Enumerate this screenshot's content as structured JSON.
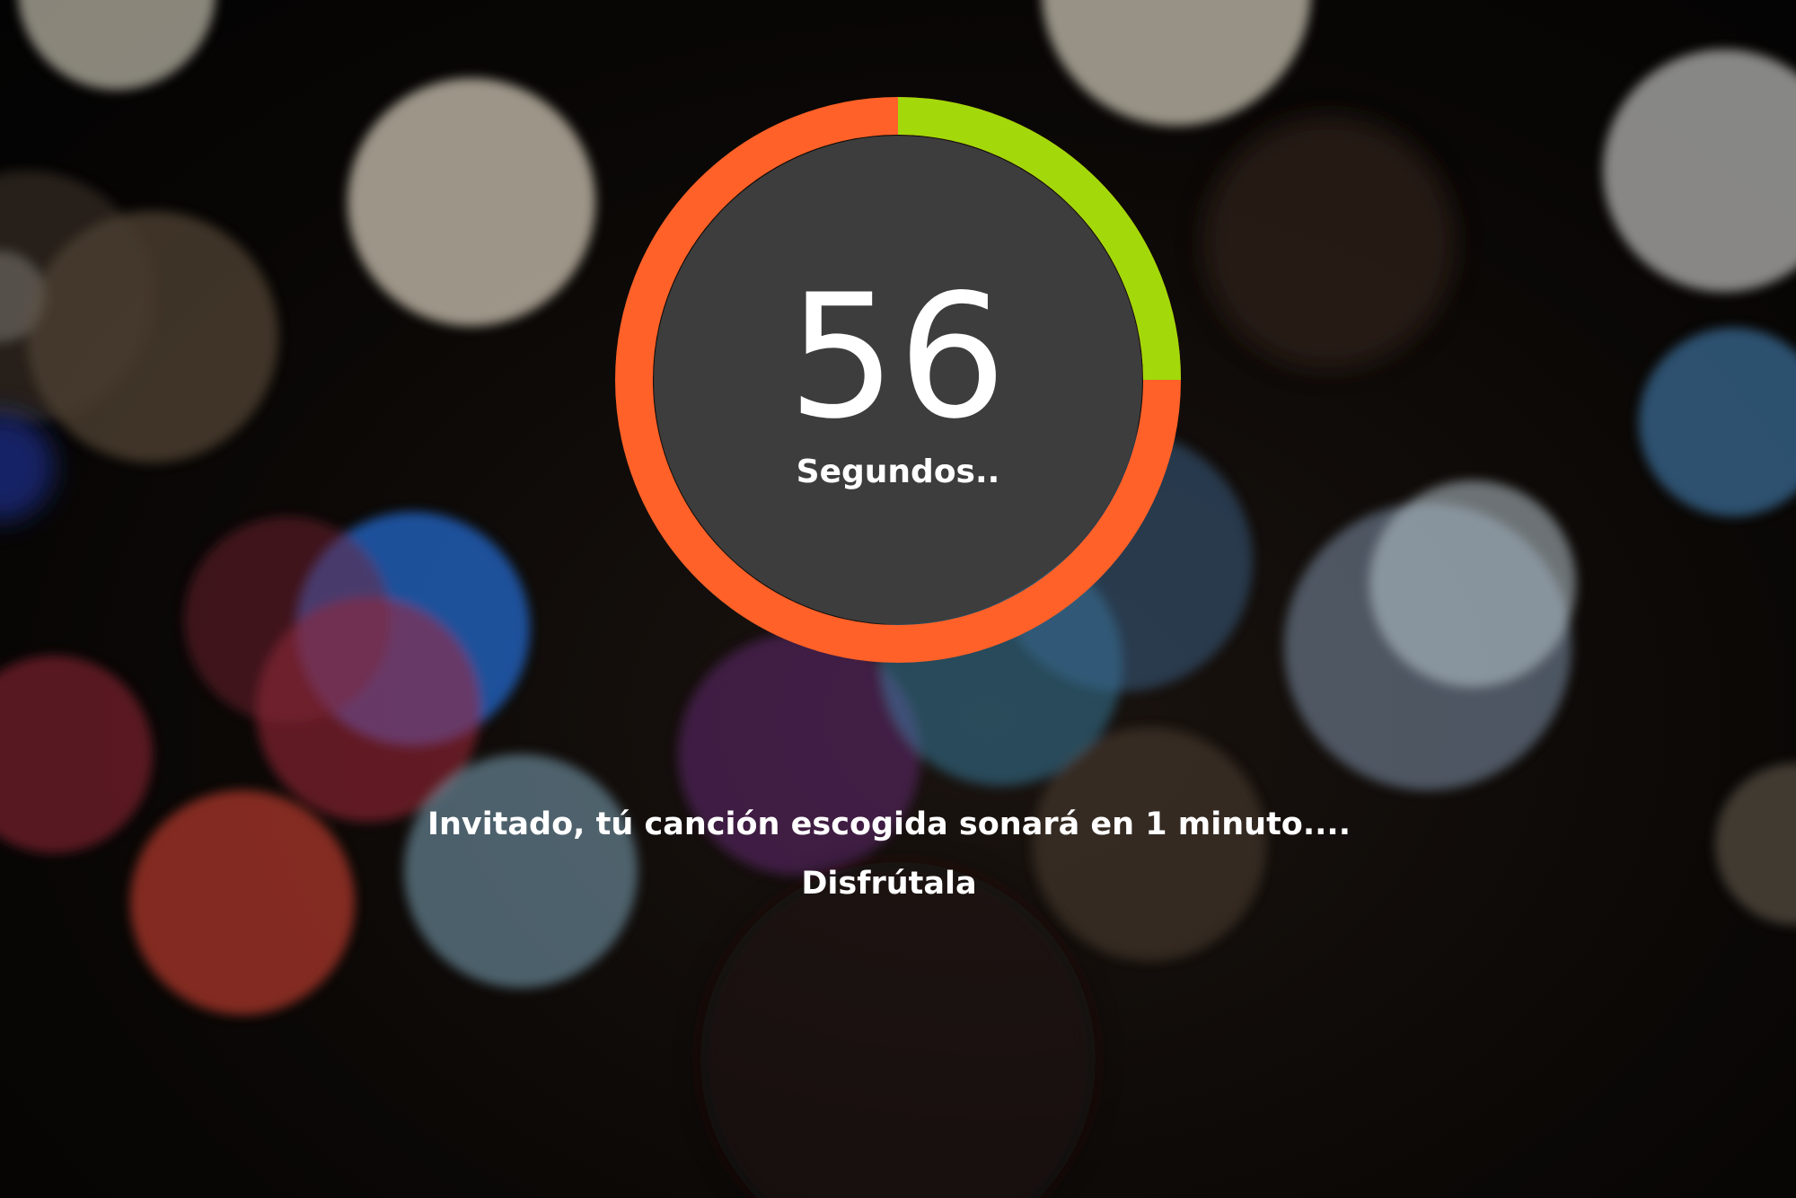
{
  "background": {
    "kind": "bokeh-lights"
  },
  "timer": {
    "count": "56",
    "unit": "Segundos..",
    "elapsed_fraction": 0.25,
    "colors": {
      "ring_remaining": "#FF6128",
      "ring_elapsed": "#A3D80A",
      "face": "#3D3D3D"
    }
  },
  "message": {
    "line1": "Invitado, tú canción escogida sonará en 1 minuto....",
    "line2": "Disfrútala"
  }
}
